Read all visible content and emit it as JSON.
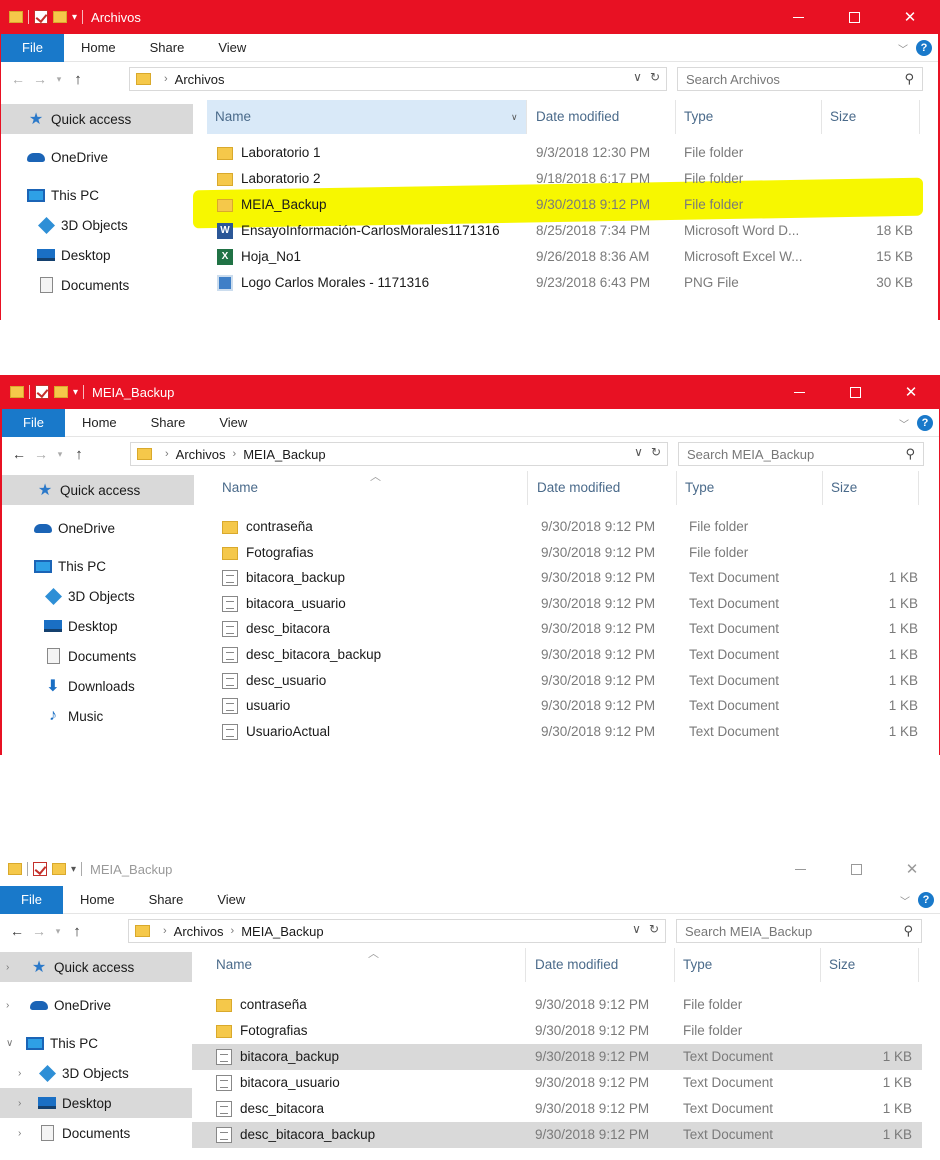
{
  "windows": [
    {
      "title": "Archivos",
      "ribbon_tabs": [
        "File",
        "Home",
        "Share",
        "View"
      ],
      "breadcrumb": [
        "Archivos"
      ],
      "search_placeholder": "Search Archivos",
      "columns": {
        "name": "Name",
        "date": "Date modified",
        "type": "Type",
        "size": "Size"
      },
      "nav": [
        "Quick access",
        "OneDrive",
        "This PC",
        "3D Objects",
        "Desktop",
        "Documents"
      ],
      "files": [
        {
          "name": "Laboratorio 1",
          "date": "9/3/2018 12:30 PM",
          "type": "File folder",
          "size": "",
          "icon": "folder-icon"
        },
        {
          "name": "Laboratorio 2",
          "date": "9/18/2018 6:17 PM",
          "type": "File folder",
          "size": "",
          "icon": "folder-icon"
        },
        {
          "name": "MEIA_Backup",
          "date": "9/30/2018 9:12 PM",
          "type": "File folder",
          "size": "",
          "icon": "folder-icon",
          "highlighted": true
        },
        {
          "name": "EnsayoInformación-CarlosMorales1171316",
          "date": "8/25/2018 7:34 PM",
          "type": "Microsoft Word D...",
          "size": "18 KB",
          "icon": "word-icon"
        },
        {
          "name": "Hoja_No1",
          "date": "9/26/2018 8:36 AM",
          "type": "Microsoft Excel W...",
          "size": "15 KB",
          "icon": "excel-icon"
        },
        {
          "name": "Logo Carlos Morales - 1171316",
          "date": "9/23/2018 6:43 PM",
          "type": "PNG File",
          "size": "30 KB",
          "icon": "png-icon"
        }
      ]
    },
    {
      "title": "MEIA_Backup",
      "ribbon_tabs": [
        "File",
        "Home",
        "Share",
        "View"
      ],
      "breadcrumb": [
        "Archivos",
        "MEIA_Backup"
      ],
      "search_placeholder": "Search MEIA_Backup",
      "columns": {
        "name": "Name",
        "date": "Date modified",
        "type": "Type",
        "size": "Size"
      },
      "nav": [
        "Quick access",
        "OneDrive",
        "This PC",
        "3D Objects",
        "Desktop",
        "Documents",
        "Downloads",
        "Music"
      ],
      "files": [
        {
          "name": "contraseña",
          "date": "9/30/2018 9:12 PM",
          "type": "File folder",
          "size": "",
          "icon": "folder-icon"
        },
        {
          "name": "Fotografias",
          "date": "9/30/2018 9:12 PM",
          "type": "File folder",
          "size": "",
          "icon": "folder-icon"
        },
        {
          "name": "bitacora_backup",
          "date": "9/30/2018 9:12 PM",
          "type": "Text Document",
          "size": "1 KB",
          "icon": "text-file-icon"
        },
        {
          "name": "bitacora_usuario",
          "date": "9/30/2018 9:12 PM",
          "type": "Text Document",
          "size": "1 KB",
          "icon": "text-file-icon"
        },
        {
          "name": "desc_bitacora",
          "date": "9/30/2018 9:12 PM",
          "type": "Text Document",
          "size": "1 KB",
          "icon": "text-file-icon"
        },
        {
          "name": "desc_bitacora_backup",
          "date": "9/30/2018 9:12 PM",
          "type": "Text Document",
          "size": "1 KB",
          "icon": "text-file-icon"
        },
        {
          "name": "desc_usuario",
          "date": "9/30/2018 9:12 PM",
          "type": "Text Document",
          "size": "1 KB",
          "icon": "text-file-icon"
        },
        {
          "name": "usuario",
          "date": "9/30/2018 9:12 PM",
          "type": "Text Document",
          "size": "1 KB",
          "icon": "text-file-icon"
        },
        {
          "name": "UsuarioActual",
          "date": "9/30/2018 9:12 PM",
          "type": "Text Document",
          "size": "1 KB",
          "icon": "text-file-icon"
        }
      ]
    },
    {
      "title": "MEIA_Backup",
      "ribbon_tabs": [
        "File",
        "Home",
        "Share",
        "View"
      ],
      "breadcrumb": [
        "Archivos",
        "MEIA_Backup"
      ],
      "search_placeholder": "Search MEIA_Backup",
      "columns": {
        "name": "Name",
        "date": "Date modified",
        "type": "Type",
        "size": "Size"
      },
      "nav": [
        "Quick access",
        "OneDrive",
        "This PC",
        "3D Objects",
        "Desktop",
        "Documents"
      ],
      "files": [
        {
          "name": "contraseña",
          "date": "9/30/2018 9:12 PM",
          "type": "File folder",
          "size": "",
          "icon": "folder-icon"
        },
        {
          "name": "Fotografias",
          "date": "9/30/2018 9:12 PM",
          "type": "File folder",
          "size": "",
          "icon": "folder-icon"
        },
        {
          "name": "bitacora_backup",
          "date": "9/30/2018 9:12 PM",
          "type": "Text Document",
          "size": "1 KB",
          "icon": "text-file-icon",
          "selected": true
        },
        {
          "name": "bitacora_usuario",
          "date": "9/30/2018 9:12 PM",
          "type": "Text Document",
          "size": "1 KB",
          "icon": "text-file-icon"
        },
        {
          "name": "desc_bitacora",
          "date": "9/30/2018 9:12 PM",
          "type": "Text Document",
          "size": "1 KB",
          "icon": "text-file-icon"
        },
        {
          "name": "desc_bitacora_backup",
          "date": "9/30/2018 9:12 PM",
          "type": "Text Document",
          "size": "1 KB",
          "icon": "text-file-icon",
          "selected": true
        }
      ]
    }
  ],
  "colors": {
    "title_red": "#e81123",
    "file_tab_blue": "#1979ca",
    "highlight_yellow": "#f7f700",
    "selection_gray": "#d9d9d9"
  }
}
